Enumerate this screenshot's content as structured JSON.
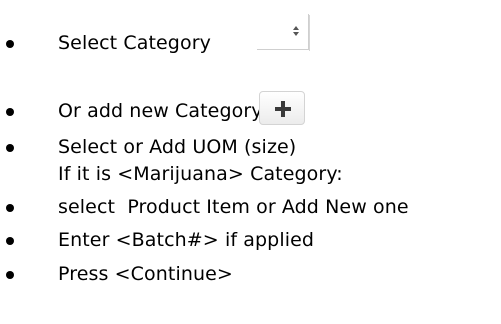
{
  "items": [
    {
      "text": "Select Category",
      "bullet": true
    },
    {
      "text": "Or add new Category",
      "bullet": true
    },
    {
      "text": "Select or Add UOM (size)",
      "bullet": true
    },
    {
      "text": "If it is <Marijuana> Category:",
      "bullet": false
    },
    {
      "text": "select  Product Item or Add New one",
      "bullet": true
    },
    {
      "text": "Enter <Batch#> if applied",
      "bullet": true
    },
    {
      "text": "Press <Continue>",
      "bullet": true
    }
  ],
  "controls": {
    "category_select_value": "",
    "add_category_icon": "plus-icon"
  }
}
